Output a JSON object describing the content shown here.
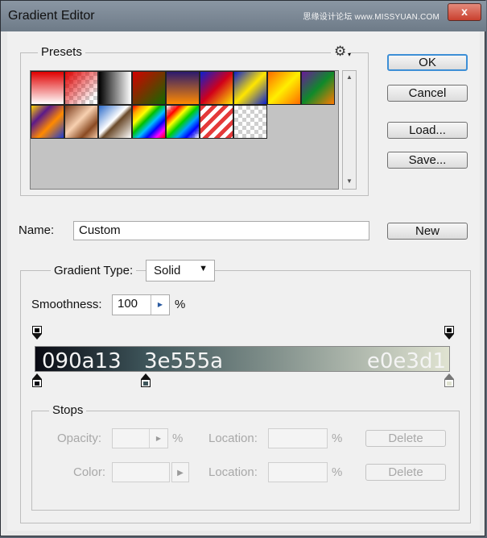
{
  "window": {
    "title": "Gradient Editor",
    "watermark": "思缘设计论坛 www.MISSYUAN.COM",
    "close_glyph": "x"
  },
  "presets": {
    "label": "Presets",
    "gear_glyph": "⚙",
    "swatches": [
      {
        "name": "fg-to-bg"
      },
      {
        "name": "fg-to-transparent"
      },
      {
        "name": "black-white"
      },
      {
        "name": "red-green"
      },
      {
        "name": "violet-orange"
      },
      {
        "name": "blue-red-yellow"
      },
      {
        "name": "blue-yellow-blue"
      },
      {
        "name": "orange-yellow-orange"
      },
      {
        "name": "violet-green-orange"
      },
      {
        "name": "yellow-violet-orange-blue"
      },
      {
        "name": "copper"
      },
      {
        "name": "chrome"
      },
      {
        "name": "spectrum"
      },
      {
        "name": "transparent-rainbow"
      },
      {
        "name": "transparent-stripes"
      },
      {
        "name": "transparent"
      }
    ],
    "scroll_up": "▲",
    "scroll_down": "▼"
  },
  "buttons": {
    "ok": "OK",
    "cancel": "Cancel",
    "load": "Load...",
    "save": "Save...",
    "new": "New"
  },
  "name_row": {
    "label": "Name:",
    "value": "Custom"
  },
  "gradient": {
    "type_label": "Gradient Type:",
    "type_value": "Solid",
    "smoothness_label": "Smoothness:",
    "smoothness_value": "100",
    "smoothness_unit": "%",
    "stop_labels": {
      "left": "090a13",
      "mid": "3e555a",
      "right": "e0e3d1"
    },
    "colors": {
      "start": "#090a13",
      "mid": "#3e555a",
      "end": "#e0e3d1"
    }
  },
  "stops": {
    "label": "Stops",
    "opacity_label": "Opacity:",
    "color_label": "Color:",
    "location_label": "Location:",
    "percent": "%",
    "delete_label": "Delete"
  }
}
